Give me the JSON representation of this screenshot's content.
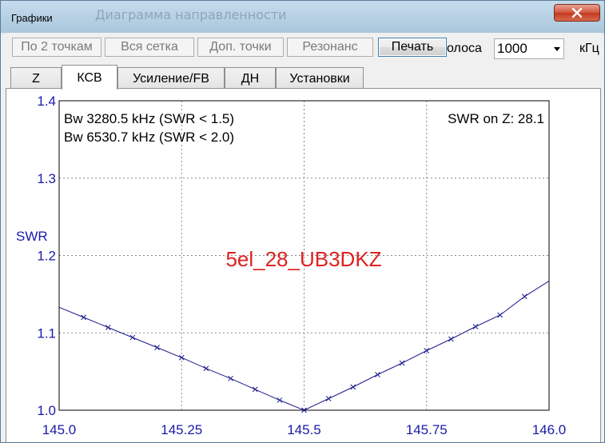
{
  "window": {
    "title": "Графики",
    "background_title": "Диаграмма направленности"
  },
  "toolbar": {
    "buttons": [
      {
        "label": "По 2 точкам",
        "enabled": false
      },
      {
        "label": "Вся сетка",
        "enabled": false
      },
      {
        "label": "Доп. точки",
        "enabled": false
      },
      {
        "label": "Резонанс",
        "enabled": false
      },
      {
        "label": "Печать",
        "enabled": true
      }
    ],
    "band_label": "олоса",
    "band_value": "1000",
    "unit_label": "кГц"
  },
  "tabs": [
    {
      "label": "Z",
      "active": false
    },
    {
      "label": "КСВ",
      "active": true
    },
    {
      "label": "Усиление/FB",
      "active": false
    },
    {
      "label": "ДН",
      "active": false
    },
    {
      "label": "Установки",
      "active": false
    }
  ],
  "colors": {
    "axis_text": "#1a1aa8",
    "curve": "#1a1a8c",
    "watermark": "#dd2222"
  },
  "chart_data": {
    "type": "line",
    "ylabel": "SWR",
    "xlim": [
      145.0,
      146.0
    ],
    "ylim": [
      1.0,
      1.4
    ],
    "x_ticks": [
      "145.0",
      "145.25",
      "145.5",
      "145.75",
      "146.0"
    ],
    "y_ticks": [
      "1.0",
      "1.1",
      "1.2",
      "1.3",
      "1.4"
    ],
    "grid": true,
    "annotations": {
      "bw1": "Bw 3280.5 kHz (SWR < 1.5)",
      "bw2": "Bw 6530.7 kHz (SWR < 2.0)",
      "swr_on_z": "SWR on Z: 28.1",
      "label": "5el_28_UB3DKZ"
    },
    "series": [
      {
        "x": [
          145.0,
          145.05,
          145.1,
          145.15,
          145.2,
          145.25,
          145.3,
          145.35,
          145.4,
          145.45,
          145.5,
          145.55,
          145.6,
          145.65,
          145.7,
          145.75,
          145.8,
          145.85,
          145.9,
          145.95,
          146.0
        ],
        "y": [
          1.133,
          1.12,
          1.107,
          1.094,
          1.081,
          1.068,
          1.054,
          1.041,
          1.027,
          1.013,
          1.0,
          1.015,
          1.03,
          1.046,
          1.061,
          1.077,
          1.092,
          1.108,
          1.123,
          1.147,
          1.167
        ],
        "markers": "x"
      }
    ]
  }
}
